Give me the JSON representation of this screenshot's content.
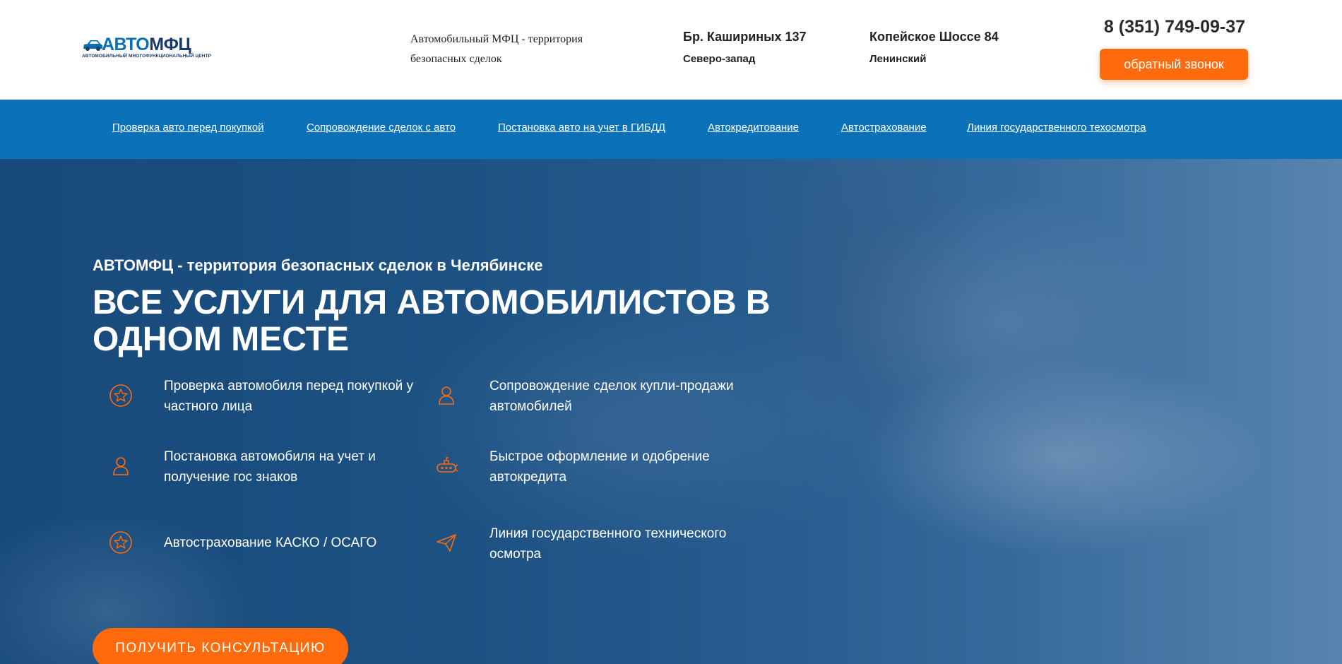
{
  "colors": {
    "accent": "#ff6a0d",
    "nav_bg": "#0b72b9",
    "brand_blue": "#0a6fb4",
    "brand_dark": "#1a3a6b"
  },
  "header": {
    "logo": {
      "word_part1": "АВТО",
      "word_part2": "МФЦ",
      "tagline": "АВТОМОБИЛЬНЫЙ МНОГОФУНКЦИОНАЛЬНЫЙ ЦЕНТР"
    },
    "slogan": "Автомобильный МФЦ - территория безопасных сделок",
    "addresses": [
      {
        "street": "Бр. Кашириных 137",
        "district": "Северо-запад"
      },
      {
        "street": "Копейское Шоссе 84",
        "district": "Ленинский"
      }
    ],
    "phone": "8 (351) 749-09-37",
    "callback_label": "обратный звонок"
  },
  "nav": {
    "items": [
      "Проверка авто перед покупкой",
      "Сопровождение сделок с авто",
      "Постановка авто на учет в ГИБДД",
      "Автокредитование",
      "Автострахование",
      "Линия государственного техосмотра"
    ]
  },
  "hero": {
    "subtitle": "АВТОМФЦ - территория безопасных сделок в Челябинске",
    "title": "ВСЕ УСЛУГИ ДЛЯ АВТОМОБИЛИСТОВ В ОДНОМ МЕСТЕ",
    "services": [
      {
        "text": "Проверка автомобиля перед покупкой у частного лица",
        "icon": "star-circle-icon"
      },
      {
        "text": "Сопровождение сделок купли-продажи автомобилей",
        "icon": "person-icon"
      },
      {
        "text": "Постановка автомобиля на учет и получение гос знаков",
        "icon": "person-icon"
      },
      {
        "text": "Быстрое оформление и одобрение автокредита",
        "icon": "submarine-icon"
      },
      {
        "text": "Автострахование КАСКО / ОСАГО",
        "icon": "star-circle-icon"
      },
      {
        "text": "Линия государственного технического осмотра",
        "icon": "paper-plane-icon"
      }
    ],
    "cta_label": "ПОЛУЧИТЬ КОНСУЛЬТАЦИЮ"
  }
}
